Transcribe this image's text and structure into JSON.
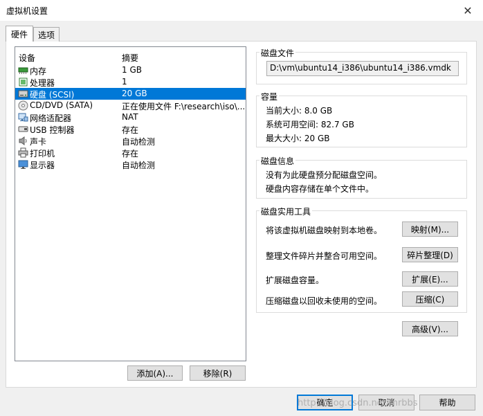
{
  "window": {
    "title": "虚拟机设置",
    "close_label": "✕"
  },
  "tabs": [
    {
      "label": "硬件"
    },
    {
      "label": "选项"
    }
  ],
  "device_list": {
    "headers": {
      "device": "设备",
      "summary": "摘要"
    },
    "items": [
      {
        "name": "内存",
        "summary": "1 GB",
        "icon": "memory-icon"
      },
      {
        "name": "处理器",
        "summary": "1",
        "icon": "processor-icon"
      },
      {
        "name": "硬盘 (SCSI)",
        "summary": "20 GB",
        "icon": "hard-disk-icon"
      },
      {
        "name": "CD/DVD (SATA)",
        "summary": "正在使用文件 F:\\research\\iso\\...",
        "icon": "cd-dvd-icon"
      },
      {
        "name": "网络适配器",
        "summary": "NAT",
        "icon": "network-adapter-icon"
      },
      {
        "name": "USB 控制器",
        "summary": "存在",
        "icon": "usb-icon"
      },
      {
        "name": "声卡",
        "summary": "自动检测",
        "icon": "sound-card-icon"
      },
      {
        "name": "打印机",
        "summary": "存在",
        "icon": "printer-icon"
      },
      {
        "name": "显示器",
        "summary": "自动检测",
        "icon": "display-icon"
      }
    ],
    "selected_index": 2,
    "add_label": "添加(A)...",
    "remove_label": "移除(R)"
  },
  "disk_file": {
    "title": "磁盘文件",
    "path": "D:\\vm\\ubuntu14_i386\\ubuntu14_i386.vmdk"
  },
  "capacity": {
    "title": "容量",
    "current": "当前大小: 8.0 GB",
    "available": "系统可用空间: 82.7 GB",
    "max": "最大大小: 20 GB"
  },
  "disk_info": {
    "title": "磁盘信息",
    "line1": "没有为此硬盘预分配磁盘空间。",
    "line2": "硬盘内容存储在单个文件中。"
  },
  "utilities": {
    "title": "磁盘实用工具",
    "map_text": "将该虚拟机磁盘映射到本地卷。",
    "map_label": "映射(M)...",
    "defrag_text": "整理文件碎片并整合可用空间。",
    "defrag_label": "碎片整理(D)",
    "expand_text": "扩展磁盘容量。",
    "expand_label": "扩展(E)...",
    "compact_text": "压缩磁盘以回收未使用的空间。",
    "compact_label": "压缩(C)"
  },
  "advanced_label": "高级(V)...",
  "footer": {
    "ok_label": "确定",
    "cancel_label": "取消",
    "help_label": "帮助"
  },
  "watermark": "http://blog.csdn.net/mrbbs"
}
